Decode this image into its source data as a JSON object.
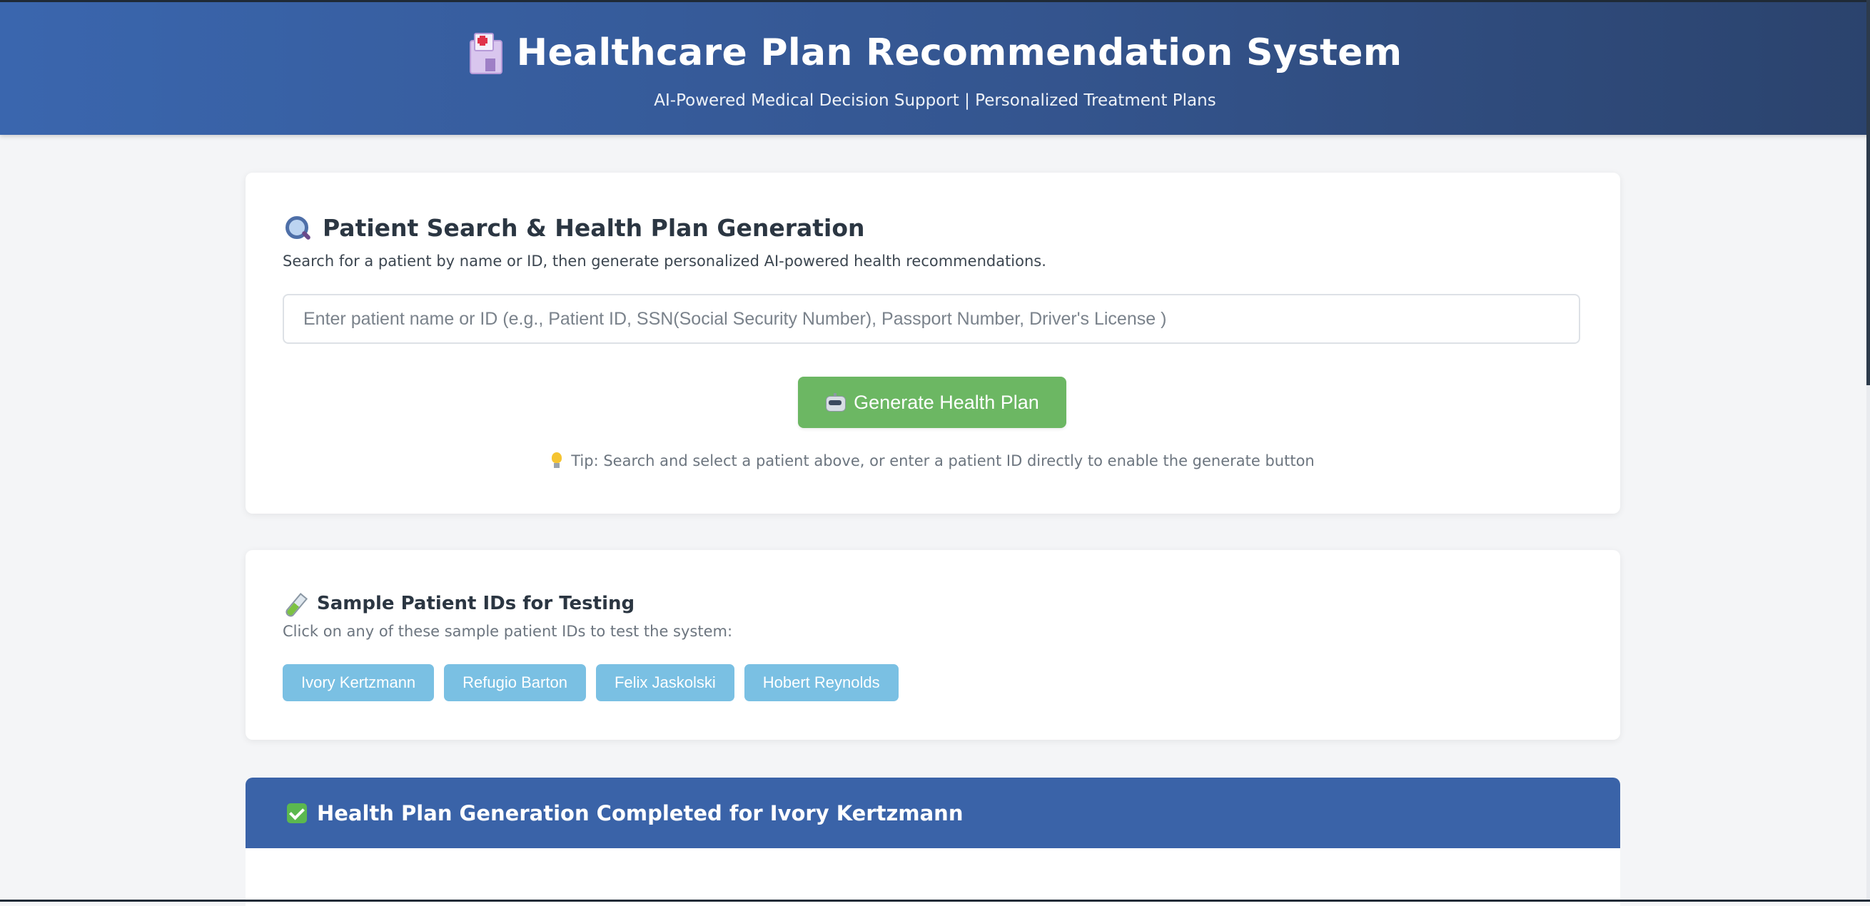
{
  "header": {
    "title": "Healthcare Plan Recommendation System",
    "subtitle": "AI-Powered Medical Decision Support | Personalized Treatment Plans",
    "icon": "hospital-icon"
  },
  "search_section": {
    "title": "Patient Search & Health Plan Generation",
    "icon": "magnifier-icon",
    "description": "Search for a patient by name or ID, then generate personalized AI-powered health recommendations.",
    "input_value": "",
    "input_placeholder": "Enter patient name or ID (e.g., Patient ID, SSN(Social Security Number), Passport Number, Driver's License )",
    "generate_button_label": "Generate Health Plan",
    "generate_button_icon": "robot-icon",
    "tip_icon": "lightbulb-icon",
    "tip": "Tip: Search and select a patient above, or enter a patient ID directly to enable the generate button"
  },
  "sample_section": {
    "title": "Sample Patient IDs for Testing",
    "icon": "test-tube-icon",
    "description": "Click on any of these sample patient IDs to test the system:",
    "patients": [
      "Ivory Kertzmann",
      "Refugio Barton",
      "Felix Jaskolski",
      "Hobert Reynolds"
    ]
  },
  "result": {
    "title": "Health Plan Generation Completed for Ivory Kertzmann",
    "icon": "check-mark-icon"
  },
  "colors": {
    "header_gradient_start": "#3a66ae",
    "header_gradient_end": "#2b436d",
    "generate_button": "#6cb763",
    "chip": "#7ac0e3",
    "result_header": "#3a63a8",
    "page_background": "#f4f5f7"
  }
}
